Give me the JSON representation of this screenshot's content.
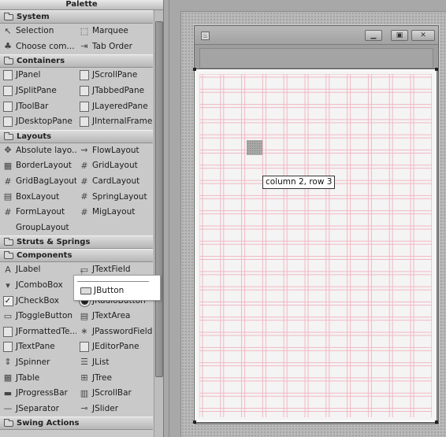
{
  "palette": {
    "title": "Palette",
    "categories": [
      {
        "name": "System",
        "items": [
          {
            "label": "Selection",
            "icon": "arrow-cursor-icon"
          },
          {
            "label": "Marquee",
            "icon": "marquee-icon"
          },
          {
            "label": "Choose com...",
            "icon": "choose-component-icon"
          },
          {
            "label": "Tab Order",
            "icon": "tab-order-icon"
          }
        ]
      },
      {
        "name": "Containers",
        "items": [
          {
            "label": "JPanel",
            "icon": "panel-icon"
          },
          {
            "label": "JScrollPane",
            "icon": "scrollpane-icon"
          },
          {
            "label": "JSplitPane",
            "icon": "splitpane-icon"
          },
          {
            "label": "JTabbedPane",
            "icon": "tabbedpane-icon"
          },
          {
            "label": "JToolBar",
            "icon": "toolbar-icon"
          },
          {
            "label": "JLayeredPane",
            "icon": "layeredpane-icon"
          },
          {
            "label": "JDesktopPane",
            "icon": "desktoppane-icon"
          },
          {
            "label": "JInternalFrame",
            "icon": "internalframe-icon"
          }
        ]
      },
      {
        "name": "Layouts",
        "items": [
          {
            "label": "Absolute layo...",
            "icon": "absolute-layout-icon"
          },
          {
            "label": "FlowLayout",
            "icon": "flowlayout-icon"
          },
          {
            "label": "BorderLayout",
            "icon": "borderlayout-icon"
          },
          {
            "label": "GridLayout",
            "icon": "gridlayout-icon"
          },
          {
            "label": "GridBagLayout",
            "icon": "gridbaglayout-icon"
          },
          {
            "label": "CardLayout",
            "icon": "cardlayout-icon"
          },
          {
            "label": "BoxLayout",
            "icon": "boxlayout-icon"
          },
          {
            "label": "SpringLayout",
            "icon": "springlayout-icon"
          },
          {
            "label": "FormLayout",
            "icon": "formlayout-icon"
          },
          {
            "label": "MigLayout",
            "icon": "miglayout-icon"
          },
          {
            "label": "GroupLayout",
            "icon": "grouplayout-icon"
          }
        ]
      },
      {
        "name": "Struts & Springs",
        "items": []
      },
      {
        "name": "Components",
        "items": [
          {
            "label": "JLabel",
            "icon": "label-icon"
          },
          {
            "label": "JTextField",
            "icon": "textfield-icon"
          },
          {
            "label": "JComboBox",
            "icon": "combobox-icon"
          },
          {
            "label": "JButton",
            "icon": "button-icon"
          },
          {
            "label": "JCheckBox",
            "icon": "checkbox-icon"
          },
          {
            "label": "JRadioButton",
            "icon": "radiobutton-icon"
          },
          {
            "label": "JToggleButton",
            "icon": "togglebutton-icon"
          },
          {
            "label": "JTextArea",
            "icon": "textarea-icon"
          },
          {
            "label": "JFormattedTe...",
            "icon": "formattedtextfield-icon"
          },
          {
            "label": "JPasswordField",
            "icon": "passwordfield-icon"
          },
          {
            "label": "JTextPane",
            "icon": "textpane-icon"
          },
          {
            "label": "JEditorPane",
            "icon": "editorpane-icon"
          },
          {
            "label": "JSpinner",
            "icon": "spinner-icon"
          },
          {
            "label": "JList",
            "icon": "list-icon"
          },
          {
            "label": "JTable",
            "icon": "table-icon"
          },
          {
            "label": "JTree",
            "icon": "tree-icon"
          },
          {
            "label": "JProgressBar",
            "icon": "progressbar-icon"
          },
          {
            "label": "JScrollBar",
            "icon": "scrollbar-icon"
          },
          {
            "label": "JSeparator",
            "icon": "separator-icon"
          },
          {
            "label": "JSlider",
            "icon": "slider-icon"
          }
        ]
      },
      {
        "name": "Swing Actions",
        "items": []
      }
    ]
  },
  "drag": {
    "label": "JButton"
  },
  "design": {
    "grid_tooltip": "column 2, row 3",
    "grid_line_color": "#f2b8c4",
    "highlight_cell": {
      "column": 2,
      "row": 3
    }
  }
}
